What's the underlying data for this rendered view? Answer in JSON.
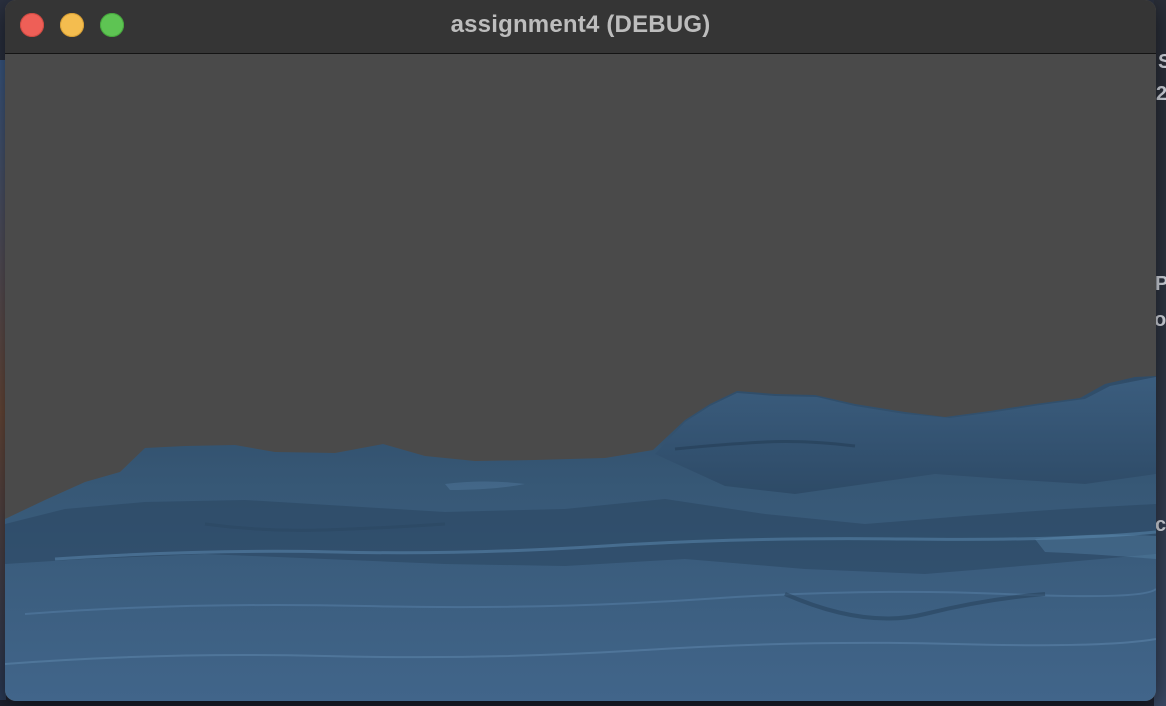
{
  "window": {
    "title": "assignment4 (DEBUG)",
    "controls": {
      "close": "close-button",
      "minimize": "minimize-button",
      "maximize": "maximize-button"
    }
  },
  "viewport": {
    "clear_color": "#4a4a4a",
    "terrain_color": "#3b5d7c",
    "terrain_shadow": "#2a4560",
    "terrain_highlight": "#5a86ad"
  },
  "colors": {
    "titlebar": "#353535",
    "title_text": "#bdbdbd",
    "close": "#ee5f57",
    "minimize": "#f4bd4f",
    "maximize": "#5ec453"
  }
}
